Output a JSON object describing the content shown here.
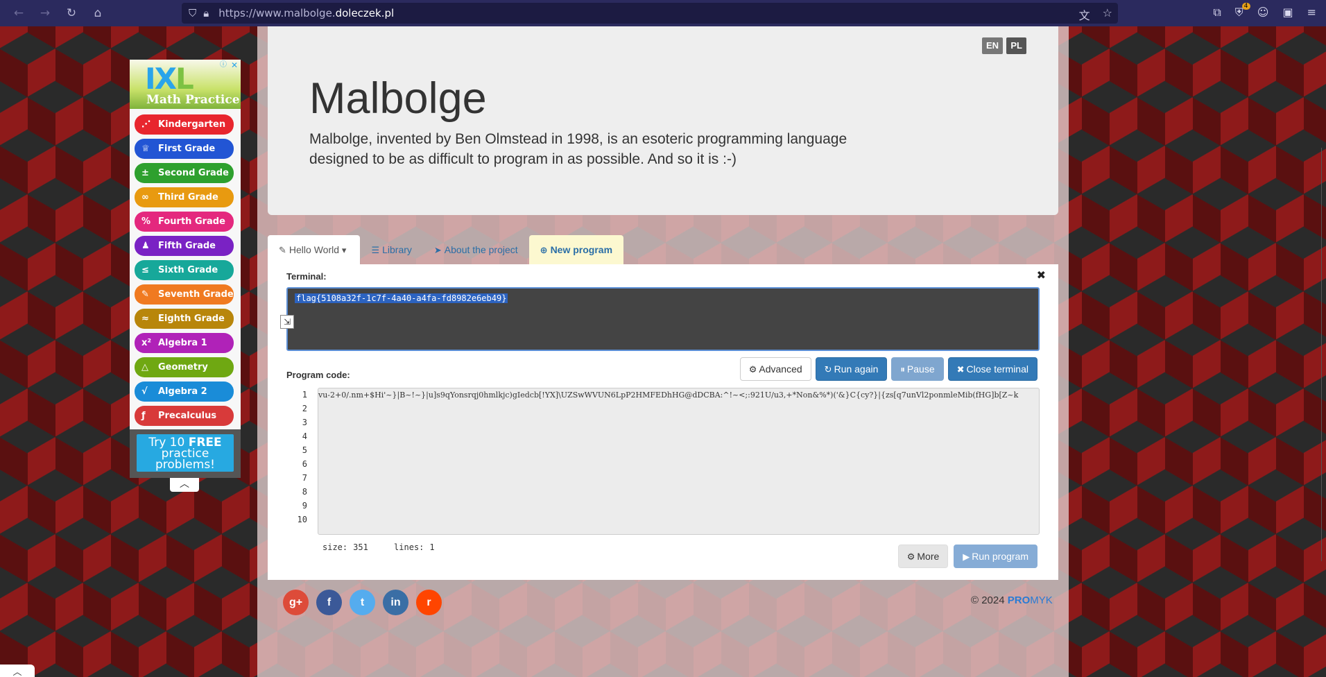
{
  "browser": {
    "url_prefix": "https://www.malbolge.",
    "url_domain": "doleczek.pl",
    "extension_badge": "4"
  },
  "header": {
    "title": "Malbolge",
    "description": "Malbolge, invented by Ben Olmstead in 1998, is an esoteric programming language designed to be as difficult to program in as possible. And so it is :-)",
    "lang_en": "EN",
    "lang_pl": "PL"
  },
  "tabs": [
    {
      "label": "Hello World",
      "icon": "edit-icon"
    },
    {
      "label": "Library",
      "icon": "list-icon"
    },
    {
      "label": "About the project",
      "icon": "send-icon"
    },
    {
      "label": "New program",
      "icon": "plus-circle-icon"
    }
  ],
  "terminal": {
    "label": "Terminal:",
    "output": "flag{5108a32f-1c7f-4a40-a4fa-fd8982e6eb49}"
  },
  "buttons": {
    "advanced": "Advanced",
    "run_again": "Run again",
    "pause": "Pause",
    "close_terminal": "Close terminal",
    "more": "More",
    "run_program": "Run program"
  },
  "program": {
    "label": "Program code:",
    "line_numbers": [
      "1",
      "2",
      "3",
      "4",
      "5",
      "6",
      "7",
      "8",
      "9",
      "10"
    ],
    "code_line_1": "vu-2+0/.nm+$Hi'~}|B~!~}|u]s9qYonsrqj0hmlkjc)gIedcb[!YX]\\UZSwWVUN6LpP2HMFEDhHG@dDCBA:^!~<;:921U/u3,+*Non&%*)('&}C{cy?}|{zs[q7unVl2ponmleMib(fHG]b[Z~k",
    "size_label": "size:",
    "size_value": "351",
    "lines_label": "lines:",
    "lines_value": "1"
  },
  "footer": {
    "social": [
      "g+",
      "f",
      "t",
      "in",
      "r"
    ],
    "copyright": "© 2024",
    "brand_pro": "PRO",
    "brand_myk": "MYK"
  },
  "ad": {
    "logo_ix": "IX",
    "logo_l": "L",
    "subtitle": "Math Practice",
    "items": [
      {
        "label": "Kindergarten",
        "color": "#e8262e",
        "icon": "⋰"
      },
      {
        "label": "First Grade",
        "color": "#2255d4",
        "icon": "♕"
      },
      {
        "label": "Second Grade",
        "color": "#2ea02e",
        "icon": "±"
      },
      {
        "label": "Third Grade",
        "color": "#e89a10",
        "icon": "∞"
      },
      {
        "label": "Fourth Grade",
        "color": "#e4287e",
        "icon": "%"
      },
      {
        "label": "Fifth Grade",
        "color": "#7a22c4",
        "icon": "♟"
      },
      {
        "label": "Sixth Grade",
        "color": "#17a89a",
        "icon": "≤"
      },
      {
        "label": "Seventh Grade",
        "color": "#f07a20",
        "icon": "✎"
      },
      {
        "label": "Eighth Grade",
        "color": "#b8860b",
        "icon": "≈"
      },
      {
        "label": "Algebra 1",
        "color": "#b022b8",
        "icon": "x²"
      },
      {
        "label": "Geometry",
        "color": "#6fa812",
        "icon": "△"
      },
      {
        "label": "Algebra 2",
        "color": "#1a8cd8",
        "icon": "√"
      },
      {
        "label": "Precalculus",
        "color": "#d83a3a",
        "icon": "ƒ"
      }
    ],
    "cta_line1": "Try 10 ",
    "cta_free": "FREE",
    "cta_line2": "practice",
    "cta_line3": "problems!"
  }
}
